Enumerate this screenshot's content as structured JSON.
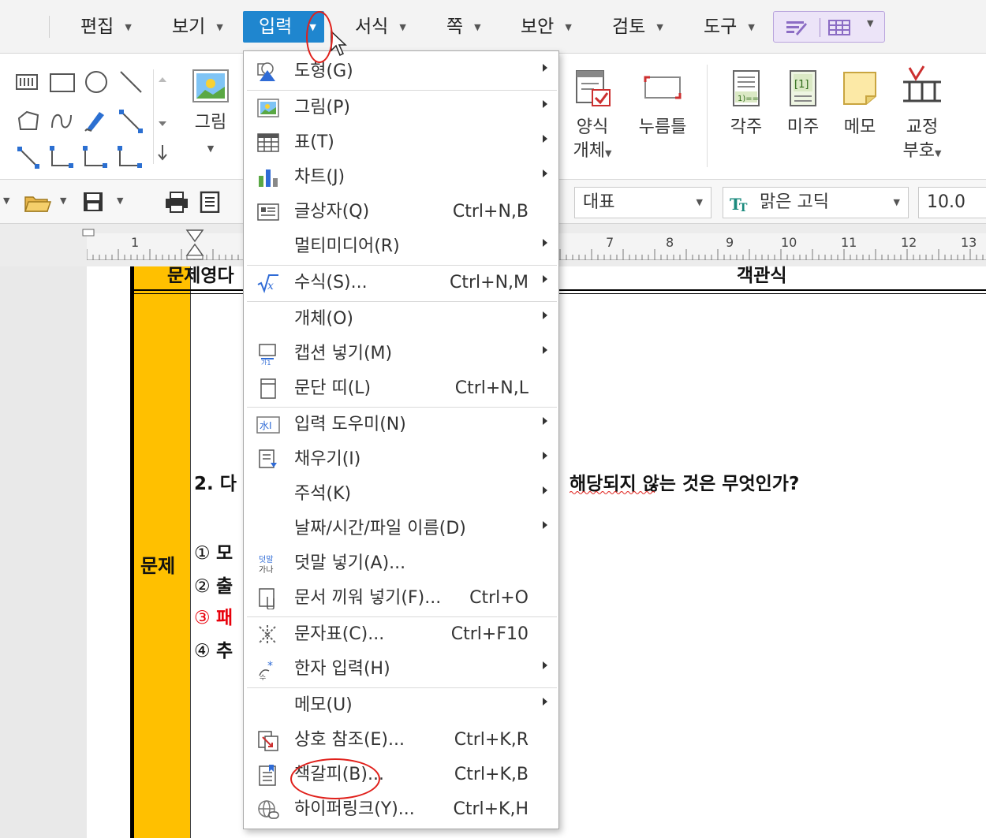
{
  "menubar": {
    "items": [
      {
        "label": "편집"
      },
      {
        "label": "보기"
      },
      {
        "label": "입력"
      },
      {
        "label": "서식"
      },
      {
        "label": "쪽"
      },
      {
        "label": "보안"
      },
      {
        "label": "검토"
      },
      {
        "label": "도구"
      }
    ],
    "active_color": "#1f86cf"
  },
  "ribbon": {
    "picture": "그림",
    "form_object_1": "양식",
    "form_object_2": "개체",
    "push_button": "누름틀",
    "footnote": "각주",
    "endnote": "미주",
    "memo": "메모",
    "proofread_1": "교정",
    "proofread_2": "부호"
  },
  "toolbar": {
    "style": "대표",
    "font": "맑은 고딕",
    "font_size": "10.0"
  },
  "ruler": {
    "numbers": [
      "1",
      "7",
      "8",
      "9",
      "10",
      "11",
      "12",
      "13"
    ]
  },
  "document": {
    "header_left": "문제영다",
    "header_right": "객관식",
    "side_label": "문제",
    "question": "2. 다",
    "question_tail": "해당되지 않는 것은 무엇인가?",
    "options": [
      {
        "num": "①",
        "text": "모"
      },
      {
        "num": "②",
        "text": "출"
      },
      {
        "num": "③",
        "text": "패"
      },
      {
        "num": "④",
        "text": "추"
      }
    ],
    "highlight_color": "#ffc000"
  },
  "dropdown": {
    "items": [
      {
        "label": "도형(G)",
        "shortcut": "",
        "icon": "shape-icon"
      },
      {
        "label": "그림(P)",
        "shortcut": "",
        "icon": "picture-icon"
      },
      {
        "label": "표(T)",
        "shortcut": "",
        "icon": "table-icon"
      },
      {
        "label": "차트(J)",
        "shortcut": "",
        "icon": "chart-icon"
      },
      {
        "label": "글상자(Q)",
        "shortcut": "Ctrl+N,B",
        "icon": "textbox-icon"
      },
      {
        "label": "멀티미디어(R)",
        "shortcut": "",
        "icon": ""
      },
      {
        "label": "수식(S)...",
        "shortcut": "Ctrl+N,M",
        "icon": "formula-icon"
      },
      {
        "label": "개체(O)",
        "shortcut": "",
        "icon": ""
      },
      {
        "label": "캡션 넣기(M)",
        "shortcut": "",
        "icon": "caption-icon"
      },
      {
        "label": "문단 띠(L)",
        "shortcut": "Ctrl+N,L",
        "icon": "paragraph-band-icon"
      },
      {
        "label": "입력 도우미(N)",
        "shortcut": "",
        "icon": "input-helper-icon"
      },
      {
        "label": "채우기(I)",
        "shortcut": "",
        "icon": "fill-icon"
      },
      {
        "label": "주석(K)",
        "shortcut": "",
        "icon": ""
      },
      {
        "label": "날짜/시간/파일 이름(D)",
        "shortcut": "",
        "icon": ""
      },
      {
        "label": "덧말 넣기(A)...",
        "shortcut": "",
        "icon": "ruby-icon"
      },
      {
        "label": "문서 끼워 넣기(F)...",
        "shortcut": "Ctrl+O",
        "icon": "insert-doc-icon"
      },
      {
        "label": "문자표(C)...",
        "shortcut": "Ctrl+F10",
        "icon": "symbol-icon"
      },
      {
        "label": "한자 입력(H)",
        "shortcut": "",
        "icon": "hanja-icon"
      },
      {
        "label": "메모(U)",
        "shortcut": "",
        "icon": ""
      },
      {
        "label": "상호 참조(E)...",
        "shortcut": "Ctrl+K,R",
        "icon": "cross-ref-icon"
      },
      {
        "label": "책갈피(B)...",
        "shortcut": "Ctrl+K,B",
        "icon": "bookmark-icon"
      },
      {
        "label": "하이퍼링크(Y)...",
        "shortcut": "Ctrl+K,H",
        "icon": "hyperlink-icon"
      }
    ],
    "ruby_glyph_top": "덧말",
    "ruby_glyph_bottom": "가나",
    "input_helper_glyph": "水I"
  },
  "annotation_color": "#e0201b"
}
